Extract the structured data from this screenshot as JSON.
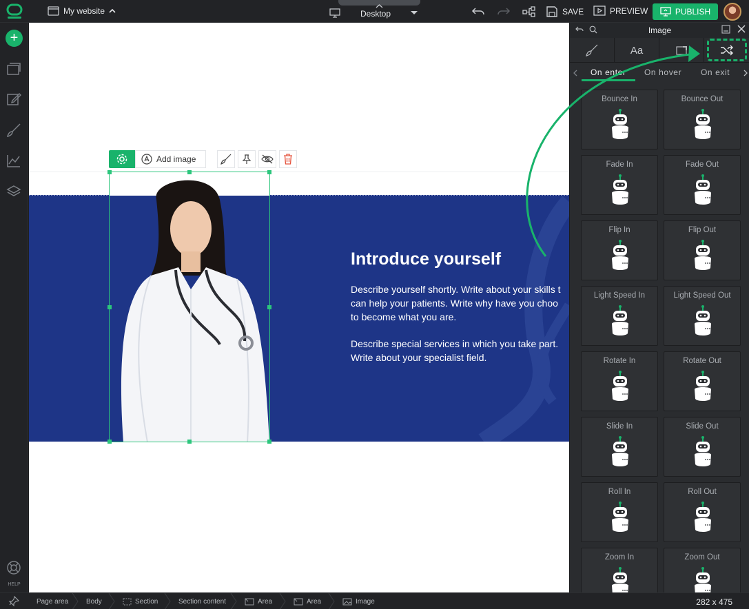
{
  "topbar": {
    "site_name": "My website",
    "device_label": "Desktop",
    "save_label": "SAVE",
    "preview_label": "PREVIEW",
    "publish_label": "PUBLISH"
  },
  "rail": {
    "help_label": "HELP"
  },
  "toolbar": {
    "add_image_label": "Add image"
  },
  "hero": {
    "title": "Introduce yourself",
    "p1_l1": "Describe yourself shortly. Write about your skills t",
    "p1_l2": "can help your patients. Write why have you choo",
    "p1_l3": "to become what you are.",
    "p2_l1": "Describe special services in which you take part.",
    "p2_l2": "Write about your specialist field."
  },
  "panel": {
    "title": "Image",
    "tab_font_glyph": "Aa",
    "subtabs": [
      "On enter",
      "On hover",
      "On exit"
    ],
    "animations": [
      "Bounce In",
      "Bounce Out",
      "Fade In",
      "Fade Out",
      "Flip In",
      "Flip Out",
      "Light Speed In",
      "Light Speed Out",
      "Rotate In",
      "Rotate Out",
      "Slide In",
      "Slide Out",
      "Roll In",
      "Roll Out",
      "Zoom In",
      "Zoom Out"
    ]
  },
  "breadcrumbs": [
    "Page area",
    "Body",
    "Section",
    "Section content",
    "Area",
    "Area",
    "Image"
  ],
  "status": {
    "dimensions": "282 x 475"
  },
  "colors": {
    "accent": "#19b36b",
    "hero_bg": "#1e3587",
    "panel_bg": "#2a2c2f"
  }
}
